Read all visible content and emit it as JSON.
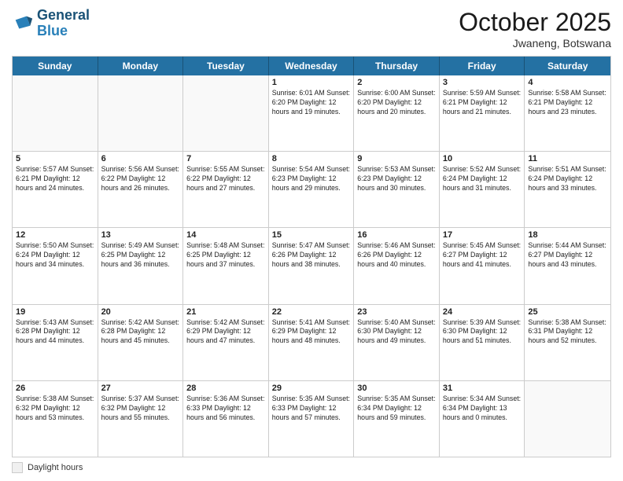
{
  "header": {
    "logo_line1": "General",
    "logo_line2": "Blue",
    "month": "October 2025",
    "location": "Jwaneng, Botswana"
  },
  "days_of_week": [
    "Sunday",
    "Monday",
    "Tuesday",
    "Wednesday",
    "Thursday",
    "Friday",
    "Saturday"
  ],
  "legend": {
    "label": "Daylight hours"
  },
  "weeks": [
    [
      {
        "day": "",
        "info": ""
      },
      {
        "day": "",
        "info": ""
      },
      {
        "day": "",
        "info": ""
      },
      {
        "day": "1",
        "info": "Sunrise: 6:01 AM\nSunset: 6:20 PM\nDaylight: 12 hours\nand 19 minutes."
      },
      {
        "day": "2",
        "info": "Sunrise: 6:00 AM\nSunset: 6:20 PM\nDaylight: 12 hours\nand 20 minutes."
      },
      {
        "day": "3",
        "info": "Sunrise: 5:59 AM\nSunset: 6:21 PM\nDaylight: 12 hours\nand 21 minutes."
      },
      {
        "day": "4",
        "info": "Sunrise: 5:58 AM\nSunset: 6:21 PM\nDaylight: 12 hours\nand 23 minutes."
      }
    ],
    [
      {
        "day": "5",
        "info": "Sunrise: 5:57 AM\nSunset: 6:21 PM\nDaylight: 12 hours\nand 24 minutes."
      },
      {
        "day": "6",
        "info": "Sunrise: 5:56 AM\nSunset: 6:22 PM\nDaylight: 12 hours\nand 26 minutes."
      },
      {
        "day": "7",
        "info": "Sunrise: 5:55 AM\nSunset: 6:22 PM\nDaylight: 12 hours\nand 27 minutes."
      },
      {
        "day": "8",
        "info": "Sunrise: 5:54 AM\nSunset: 6:23 PM\nDaylight: 12 hours\nand 29 minutes."
      },
      {
        "day": "9",
        "info": "Sunrise: 5:53 AM\nSunset: 6:23 PM\nDaylight: 12 hours\nand 30 minutes."
      },
      {
        "day": "10",
        "info": "Sunrise: 5:52 AM\nSunset: 6:24 PM\nDaylight: 12 hours\nand 31 minutes."
      },
      {
        "day": "11",
        "info": "Sunrise: 5:51 AM\nSunset: 6:24 PM\nDaylight: 12 hours\nand 33 minutes."
      }
    ],
    [
      {
        "day": "12",
        "info": "Sunrise: 5:50 AM\nSunset: 6:24 PM\nDaylight: 12 hours\nand 34 minutes."
      },
      {
        "day": "13",
        "info": "Sunrise: 5:49 AM\nSunset: 6:25 PM\nDaylight: 12 hours\nand 36 minutes."
      },
      {
        "day": "14",
        "info": "Sunrise: 5:48 AM\nSunset: 6:25 PM\nDaylight: 12 hours\nand 37 minutes."
      },
      {
        "day": "15",
        "info": "Sunrise: 5:47 AM\nSunset: 6:26 PM\nDaylight: 12 hours\nand 38 minutes."
      },
      {
        "day": "16",
        "info": "Sunrise: 5:46 AM\nSunset: 6:26 PM\nDaylight: 12 hours\nand 40 minutes."
      },
      {
        "day": "17",
        "info": "Sunrise: 5:45 AM\nSunset: 6:27 PM\nDaylight: 12 hours\nand 41 minutes."
      },
      {
        "day": "18",
        "info": "Sunrise: 5:44 AM\nSunset: 6:27 PM\nDaylight: 12 hours\nand 43 minutes."
      }
    ],
    [
      {
        "day": "19",
        "info": "Sunrise: 5:43 AM\nSunset: 6:28 PM\nDaylight: 12 hours\nand 44 minutes."
      },
      {
        "day": "20",
        "info": "Sunrise: 5:42 AM\nSunset: 6:28 PM\nDaylight: 12 hours\nand 45 minutes."
      },
      {
        "day": "21",
        "info": "Sunrise: 5:42 AM\nSunset: 6:29 PM\nDaylight: 12 hours\nand 47 minutes."
      },
      {
        "day": "22",
        "info": "Sunrise: 5:41 AM\nSunset: 6:29 PM\nDaylight: 12 hours\nand 48 minutes."
      },
      {
        "day": "23",
        "info": "Sunrise: 5:40 AM\nSunset: 6:30 PM\nDaylight: 12 hours\nand 49 minutes."
      },
      {
        "day": "24",
        "info": "Sunrise: 5:39 AM\nSunset: 6:30 PM\nDaylight: 12 hours\nand 51 minutes."
      },
      {
        "day": "25",
        "info": "Sunrise: 5:38 AM\nSunset: 6:31 PM\nDaylight: 12 hours\nand 52 minutes."
      }
    ],
    [
      {
        "day": "26",
        "info": "Sunrise: 5:38 AM\nSunset: 6:32 PM\nDaylight: 12 hours\nand 53 minutes."
      },
      {
        "day": "27",
        "info": "Sunrise: 5:37 AM\nSunset: 6:32 PM\nDaylight: 12 hours\nand 55 minutes."
      },
      {
        "day": "28",
        "info": "Sunrise: 5:36 AM\nSunset: 6:33 PM\nDaylight: 12 hours\nand 56 minutes."
      },
      {
        "day": "29",
        "info": "Sunrise: 5:35 AM\nSunset: 6:33 PM\nDaylight: 12 hours\nand 57 minutes."
      },
      {
        "day": "30",
        "info": "Sunrise: 5:35 AM\nSunset: 6:34 PM\nDaylight: 12 hours\nand 59 minutes."
      },
      {
        "day": "31",
        "info": "Sunrise: 5:34 AM\nSunset: 6:34 PM\nDaylight: 13 hours\nand 0 minutes."
      },
      {
        "day": "",
        "info": ""
      }
    ]
  ]
}
